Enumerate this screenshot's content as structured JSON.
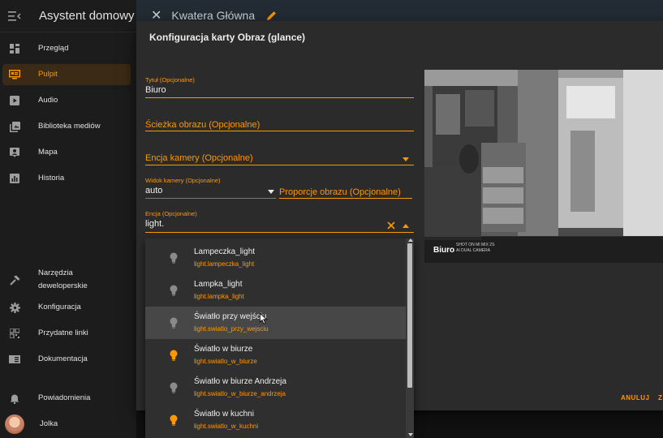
{
  "app": {
    "title": "Asystent domowy"
  },
  "sidebar": {
    "items": [
      {
        "label": "Przegląd",
        "icon": "dashboard-icon"
      },
      {
        "label": "Pulpit",
        "icon": "monitor-dashboard-icon",
        "active": true
      },
      {
        "label": "Audio",
        "icon": "play-box-icon"
      },
      {
        "label": "Biblioteka mediów",
        "icon": "media-library-icon"
      },
      {
        "label": "Mapa",
        "icon": "map-account-icon"
      },
      {
        "label": "Historia",
        "icon": "chart-box-icon"
      }
    ],
    "bottom_items": [
      {
        "label_line1": "Narzędzia",
        "label_line2": "deweloperskie",
        "icon": "hammer-icon"
      },
      {
        "label": "Konfiguracja",
        "icon": "cog-icon"
      },
      {
        "label": "Przydatne linki",
        "icon": "qrcode-icon"
      },
      {
        "label": "Dokumentacja",
        "icon": "book-icon"
      },
      {
        "label": "Powiadomienia",
        "icon": "bell-icon"
      },
      {
        "label": "Jolka",
        "icon": "avatar"
      }
    ]
  },
  "topbar": {
    "title": "Kwatera Główna"
  },
  "dialog": {
    "title": "Konfiguracja karty Obraz (glance)",
    "fields": {
      "title": {
        "label": "Tytuł (Opcjonalne)",
        "value": "Biuro"
      },
      "image_path": {
        "placeholder": "Ścieżka obrazu (Opcjonalne)"
      },
      "camera_entity": {
        "placeholder": "Encja kamery (Opcjonalne)"
      },
      "camera_view": {
        "label": "Widok kamery (Opcjonalne)",
        "value": "auto"
      },
      "aspect_ratio": {
        "placeholder": "Proporcje obrazu (Opcjonalne)"
      },
      "entity": {
        "label": "Encja (Opcjonalne)",
        "value": "light."
      }
    },
    "preview": {
      "label": "Biuro",
      "watermark_line1": "SHOT ON MI MIX 2S",
      "watermark_line2": "AI DUAL CAMERA"
    },
    "actions": {
      "cancel": "ANULUJ",
      "save_partial": "Z"
    }
  },
  "dropdown": {
    "items": [
      {
        "name": "Lampeczka_light",
        "entity_id": "light.lampeczka_light",
        "state": "off"
      },
      {
        "name": "Lampka_light",
        "entity_id": "light.lampka_light",
        "state": "off"
      },
      {
        "name": "Światło przy wejściu",
        "entity_id": "light.swiatlo_przy_wejsciu",
        "state": "off",
        "hover": true
      },
      {
        "name": "Światło w biurze",
        "entity_id": "light.swiatlo_w_biurze",
        "state": "on"
      },
      {
        "name": "Światło w biurze Andrzeja",
        "entity_id": "light.swiatlo_w_biurze_andrzeja",
        "state": "off"
      },
      {
        "name": "Światło w kuchni",
        "entity_id": "light.swiatlo_w_kuchni",
        "state": "on"
      }
    ]
  },
  "colors": {
    "accent": "#ff9800",
    "sidebar_bg": "#1c1c1c",
    "dialog_bg": "#2b2b2b",
    "bulb_off": "#8a8a8a",
    "bulb_on": "#ff9800"
  }
}
